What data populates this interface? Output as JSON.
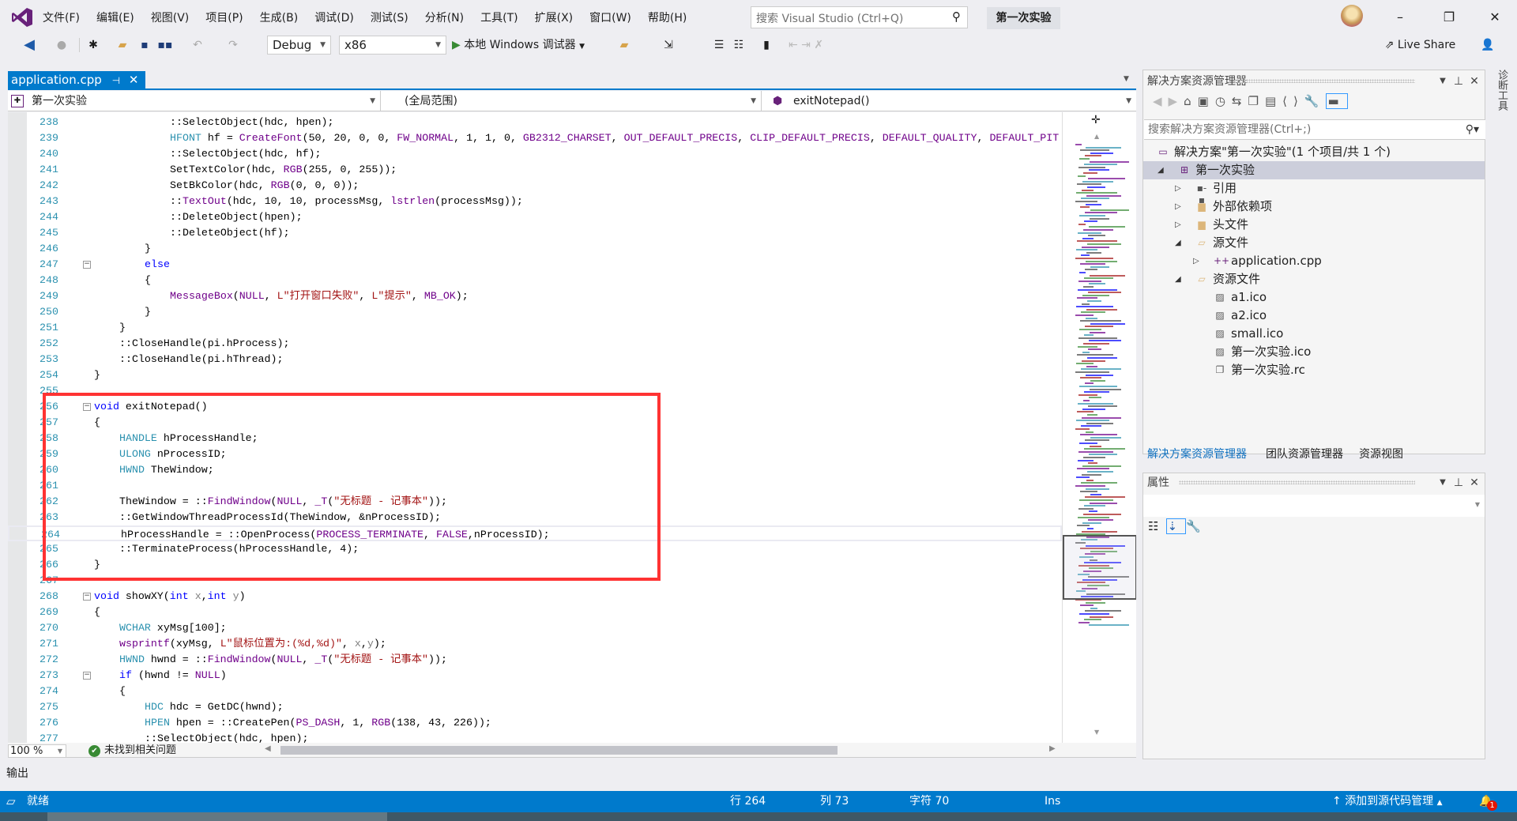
{
  "menubar": {
    "items": [
      "文件(F)",
      "编辑(E)",
      "视图(V)",
      "项目(P)",
      "生成(B)",
      "调试(D)",
      "测试(S)",
      "分析(N)",
      "工具(T)",
      "扩展(X)",
      "窗口(W)",
      "帮助(H)"
    ],
    "search_placeholder": "搜索 Visual Studio (Ctrl+Q)",
    "project_name": "第一次实验",
    "accent": "#68217a"
  },
  "toolbar": {
    "config": "Debug",
    "platform": "x86",
    "run_label": "本地 Windows 调试器",
    "live_share": "Live Share"
  },
  "editor": {
    "tab_label": "application.cpp",
    "nav": {
      "project": "第一次实验",
      "scope": "(全局范围)",
      "member": "exitNotepad()"
    },
    "current_line": 264,
    "highlight_color": "#ff3333",
    "lines": [
      {
        "n": "238",
        "i": 12,
        "t": [
          [
            "pl",
            "::SelectObject(hdc, hpen);"
          ]
        ]
      },
      {
        "n": "239",
        "i": 12,
        "t": [
          [
            "ty",
            "HFONT"
          ],
          [
            "pl",
            " hf = "
          ],
          [
            "mac",
            "CreateFont"
          ],
          [
            "pl",
            "(50, 20, 0, 0, "
          ],
          [
            "mac",
            "FW_NORMAL"
          ],
          [
            "pl",
            ", 1, 1, 0, "
          ],
          [
            "mac",
            "GB2312_CHARSET"
          ],
          [
            "pl",
            ", "
          ],
          [
            "mac",
            "OUT_DEFAULT_PRECIS"
          ],
          [
            "pl",
            ", "
          ],
          [
            "mac",
            "CLIP_DEFAULT_PRECIS"
          ],
          [
            "pl",
            ", "
          ],
          [
            "mac",
            "DEFAULT_QUALITY"
          ],
          [
            "pl",
            ", "
          ],
          [
            "mac",
            "DEFAULT_PIT"
          ]
        ]
      },
      {
        "n": "240",
        "i": 12,
        "t": [
          [
            "pl",
            "::SelectObject(hdc, hf);"
          ]
        ]
      },
      {
        "n": "241",
        "i": 12,
        "t": [
          [
            "pl",
            "SetTextColor(hdc, "
          ],
          [
            "mac",
            "RGB"
          ],
          [
            "pl",
            "(255, 0, 255));"
          ]
        ]
      },
      {
        "n": "242",
        "i": 12,
        "t": [
          [
            "pl",
            "SetBkColor(hdc, "
          ],
          [
            "mac",
            "RGB"
          ],
          [
            "pl",
            "(0, 0, 0));"
          ]
        ]
      },
      {
        "n": "243",
        "i": 12,
        "t": [
          [
            "pl",
            "::"
          ],
          [
            "mac",
            "TextOut"
          ],
          [
            "pl",
            "(hdc, 10, 10, processMsg, "
          ],
          [
            "mac",
            "lstrlen"
          ],
          [
            "pl",
            "(processMsg));"
          ]
        ]
      },
      {
        "n": "244",
        "i": 12,
        "t": [
          [
            "pl",
            "::DeleteObject(hpen);"
          ]
        ]
      },
      {
        "n": "245",
        "i": 12,
        "t": [
          [
            "pl",
            "::DeleteObject(hf);"
          ]
        ]
      },
      {
        "n": "246",
        "i": 8,
        "t": [
          [
            "pl",
            "}"
          ]
        ]
      },
      {
        "n": "247",
        "i": 8,
        "f": true,
        "t": [
          [
            "kw",
            "else"
          ]
        ]
      },
      {
        "n": "248",
        "i": 8,
        "t": [
          [
            "pl",
            "{"
          ]
        ]
      },
      {
        "n": "249",
        "i": 12,
        "t": [
          [
            "mac",
            "MessageBox"
          ],
          [
            "pl",
            "("
          ],
          [
            "mac",
            "NULL"
          ],
          [
            "pl",
            ", "
          ],
          [
            "str",
            "L\"打开窗口失败\""
          ],
          [
            "pl",
            ", "
          ],
          [
            "str",
            "L\"提示\""
          ],
          [
            "pl",
            ", "
          ],
          [
            "mac",
            "MB_OK"
          ],
          [
            "pl",
            ");"
          ]
        ]
      },
      {
        "n": "250",
        "i": 8,
        "t": [
          [
            "pl",
            "}"
          ]
        ]
      },
      {
        "n": "251",
        "i": 4,
        "t": [
          [
            "pl",
            "}"
          ]
        ]
      },
      {
        "n": "252",
        "i": 4,
        "t": [
          [
            "pl",
            "::CloseHandle(pi.hProcess);"
          ]
        ]
      },
      {
        "n": "253",
        "i": 4,
        "t": [
          [
            "pl",
            "::CloseHandle(pi.hThread);"
          ]
        ]
      },
      {
        "n": "254",
        "i": 0,
        "t": [
          [
            "pl",
            "}"
          ]
        ]
      },
      {
        "n": "255",
        "i": 0,
        "t": []
      },
      {
        "n": "256",
        "i": 0,
        "f": true,
        "t": [
          [
            "kw",
            "void"
          ],
          [
            "pl",
            " exitNotepad()"
          ]
        ]
      },
      {
        "n": "257",
        "i": 0,
        "t": [
          [
            "pl",
            "{"
          ]
        ]
      },
      {
        "n": "258",
        "i": 4,
        "t": [
          [
            "ty",
            "HANDLE"
          ],
          [
            "pl",
            " hProcessHandle;"
          ]
        ]
      },
      {
        "n": "259",
        "i": 4,
        "t": [
          [
            "ty",
            "ULONG"
          ],
          [
            "pl",
            " nProcessID;"
          ]
        ]
      },
      {
        "n": "260",
        "i": 4,
        "t": [
          [
            "ty",
            "HWND"
          ],
          [
            "pl",
            " TheWindow;"
          ]
        ]
      },
      {
        "n": "261",
        "i": 0,
        "t": []
      },
      {
        "n": "262",
        "i": 4,
        "t": [
          [
            "pl",
            "TheWindow = ::"
          ],
          [
            "mac",
            "FindWindow"
          ],
          [
            "pl",
            "("
          ],
          [
            "mac",
            "NULL"
          ],
          [
            "pl",
            ", "
          ],
          [
            "mac",
            "_T"
          ],
          [
            "pl",
            "("
          ],
          [
            "str",
            "\"无标题 - 记事本\""
          ],
          [
            "pl",
            "));"
          ]
        ]
      },
      {
        "n": "263",
        "i": 4,
        "t": [
          [
            "pl",
            "::GetWindowThreadProcessId(TheWindow, &nProcessID);"
          ]
        ]
      },
      {
        "n": "264",
        "i": 4,
        "t": [
          [
            "pl",
            "hProcessHandle = ::OpenProcess("
          ],
          [
            "mac",
            "PROCESS_TERMINATE"
          ],
          [
            "pl",
            ", "
          ],
          [
            "mac",
            "FALSE"
          ],
          [
            "pl",
            ",nProcessID);"
          ]
        ]
      },
      {
        "n": "265",
        "i": 4,
        "t": [
          [
            "pl",
            "::TerminateProcess(hProcessHandle, 4);"
          ]
        ]
      },
      {
        "n": "266",
        "i": 0,
        "t": [
          [
            "pl",
            "}"
          ]
        ]
      },
      {
        "n": "267",
        "i": 0,
        "t": []
      },
      {
        "n": "268",
        "i": 0,
        "f": true,
        "t": [
          [
            "kw",
            "void"
          ],
          [
            "pl",
            " showXY("
          ],
          [
            "kw",
            "int"
          ],
          [
            "pl",
            " "
          ],
          [
            "par",
            "x"
          ],
          [
            "pl",
            ","
          ],
          [
            "kw",
            "int"
          ],
          [
            "pl",
            " "
          ],
          [
            "par",
            "y"
          ],
          [
            "pl",
            ")"
          ]
        ]
      },
      {
        "n": "269",
        "i": 0,
        "t": [
          [
            "pl",
            "{"
          ]
        ]
      },
      {
        "n": "270",
        "i": 4,
        "t": [
          [
            "ty",
            "WCHAR"
          ],
          [
            "pl",
            " xyMsg[100];"
          ]
        ]
      },
      {
        "n": "271",
        "i": 4,
        "t": [
          [
            "mac",
            "wsprintf"
          ],
          [
            "pl",
            "(xyMsg, "
          ],
          [
            "str",
            "L\"鼠标位置为:(%d,%d)\""
          ],
          [
            "pl",
            ", "
          ],
          [
            "par",
            "x"
          ],
          [
            "pl",
            ","
          ],
          [
            "par",
            "y"
          ],
          [
            "pl",
            ");"
          ]
        ]
      },
      {
        "n": "272",
        "i": 4,
        "t": [
          [
            "ty",
            "HWND"
          ],
          [
            "pl",
            " hwnd = ::"
          ],
          [
            "mac",
            "FindWindow"
          ],
          [
            "pl",
            "("
          ],
          [
            "mac",
            "NULL"
          ],
          [
            "pl",
            ", "
          ],
          [
            "mac",
            "_T"
          ],
          [
            "pl",
            "("
          ],
          [
            "str",
            "\"无标题 - 记事本\""
          ],
          [
            "pl",
            "));"
          ]
        ]
      },
      {
        "n": "273",
        "i": 4,
        "f": true,
        "t": [
          [
            "kw",
            "if"
          ],
          [
            "pl",
            " (hwnd != "
          ],
          [
            "mac",
            "NULL"
          ],
          [
            "pl",
            ")"
          ]
        ]
      },
      {
        "n": "274",
        "i": 4,
        "t": [
          [
            "pl",
            "{"
          ]
        ]
      },
      {
        "n": "275",
        "i": 8,
        "t": [
          [
            "ty",
            "HDC"
          ],
          [
            "pl",
            " hdc = GetDC(hwnd);"
          ]
        ]
      },
      {
        "n": "276",
        "i": 8,
        "t": [
          [
            "ty",
            "HPEN"
          ],
          [
            "pl",
            " hpen = ::CreatePen("
          ],
          [
            "mac",
            "PS_DASH"
          ],
          [
            "pl",
            ", 1, "
          ],
          [
            "mac",
            "RGB"
          ],
          [
            "pl",
            "(138, 43, 226));"
          ]
        ]
      },
      {
        "n": "277",
        "i": 8,
        "t": [
          [
            "pl",
            "::SelectObject(hdc, hpen);"
          ]
        ]
      }
    ],
    "zoom": "100 %",
    "issues": "未找到相关问题"
  },
  "output_label": "输出",
  "solution_explorer": {
    "title": "解决方案资源管理器",
    "search_placeholder": "搜索解决方案资源管理器(Ctrl+;)",
    "tree": [
      {
        "label": "解决方案\"第一次实验\"(1 个项目/共 1 个)",
        "level": 0,
        "exp": "",
        "icon": "solution-icon",
        "glyph": "▭"
      },
      {
        "label": "第一次实验",
        "level": 1,
        "exp": "open",
        "icon": "project-icon",
        "glyph": "⊞",
        "selected": true
      },
      {
        "label": "引用",
        "level": 2,
        "exp": "closed",
        "icon": "references-icon",
        "glyph": "▪-▪"
      },
      {
        "label": "外部依赖项",
        "level": 2,
        "exp": "closed",
        "icon": "folder-icon",
        "glyph": "▆"
      },
      {
        "label": "头文件",
        "level": 2,
        "exp": "closed",
        "icon": "folder-icon",
        "glyph": "▆"
      },
      {
        "label": "源文件",
        "level": 2,
        "exp": "open",
        "icon": "open-folder-icon",
        "glyph": "▱"
      },
      {
        "label": "application.cpp",
        "level": 3,
        "exp": "closed",
        "icon": "cpp-file-icon",
        "glyph": "++"
      },
      {
        "label": "资源文件",
        "level": 2,
        "exp": "open",
        "icon": "open-folder-icon",
        "glyph": "▱"
      },
      {
        "label": "a1.ico",
        "level": 3,
        "exp": "",
        "icon": "image-file-icon",
        "glyph": "▨"
      },
      {
        "label": "a2.ico",
        "level": 3,
        "exp": "",
        "icon": "image-file-icon",
        "glyph": "▨"
      },
      {
        "label": "small.ico",
        "level": 3,
        "exp": "",
        "icon": "image-file-icon",
        "glyph": "▨"
      },
      {
        "label": "第一次实验.ico",
        "level": 3,
        "exp": "",
        "icon": "image-file-icon",
        "glyph": "▨"
      },
      {
        "label": "第一次实验.rc",
        "level": 3,
        "exp": "",
        "icon": "resource-file-icon",
        "glyph": "❐"
      }
    ],
    "tabs": [
      "解决方案资源管理器",
      "团队资源管理器",
      "资源视图"
    ]
  },
  "properties": {
    "title": "属性"
  },
  "diagnostics_tab": "诊断工具",
  "statusbar": {
    "ready": "就绪",
    "line": "行 264",
    "col": "列 73",
    "char": "字符 70",
    "mode": "Ins",
    "source_control": "添加到源代码管理",
    "notifications": "1"
  }
}
